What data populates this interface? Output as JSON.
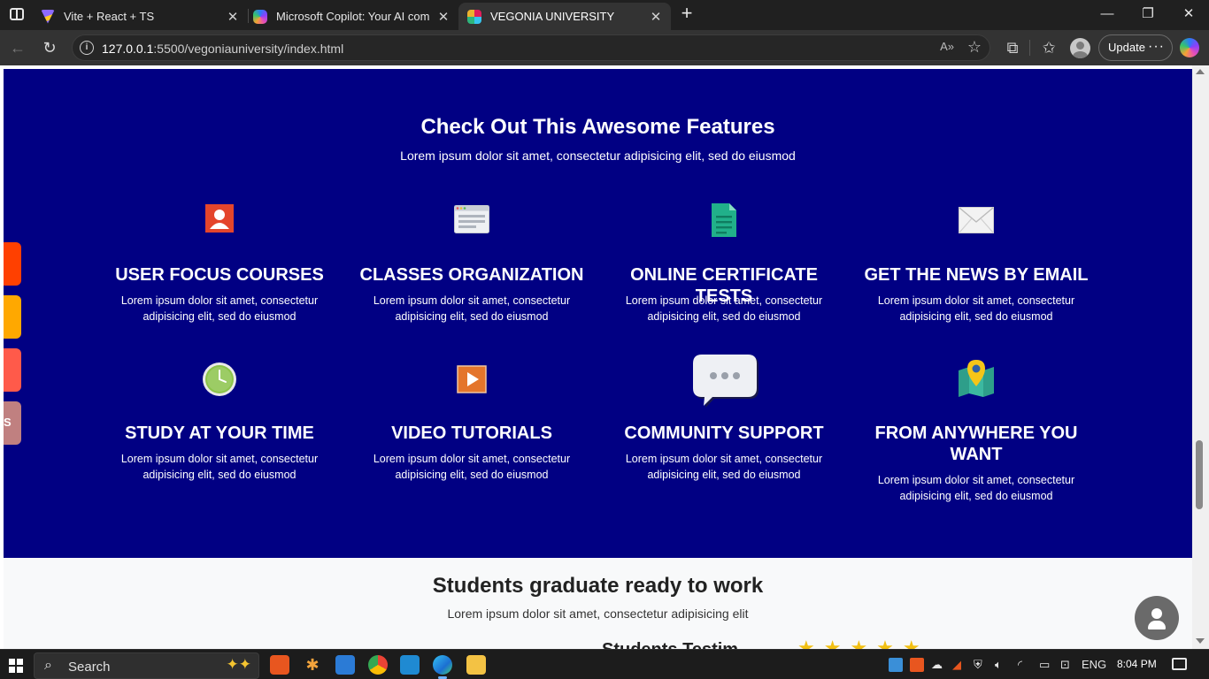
{
  "browser": {
    "tabs": [
      {
        "title": "Vite + React + TS",
        "close": "✕"
      },
      {
        "title": "Microsoft Copilot: Your AI compa",
        "close": "✕"
      },
      {
        "title": "VEGONIA UNIVERSITY",
        "close": "✕"
      }
    ],
    "new_tab": "+",
    "window_controls": {
      "minimize": "—",
      "restore": "❐",
      "close": "✕"
    },
    "url_host": "127.0.0.1",
    "url_path": ":5500/vegoniauniversity/index.html",
    "read_aloud": "A»",
    "update_label": "Update",
    "menu_dots": "···"
  },
  "features": {
    "title": "Check Out This Awesome Features",
    "subtitle": "Lorem ipsum dolor sit amet, consectetur adipisicing elit, sed do eiusmod",
    "items": [
      {
        "title": "USER FOCUS COURSES",
        "desc": "Lorem ipsum dolor sit amet, consectetur adipisicing elit, sed do eiusmod",
        "icon": "user-card-icon"
      },
      {
        "title": "CLASSES ORGANIZATION",
        "desc": "Lorem ipsum dolor sit amet, consectetur adipisicing elit, sed do eiusmod",
        "icon": "browser-window-icon"
      },
      {
        "title": "ONLINE CERTIFICATE TESTS",
        "desc": "Lorem ipsum dolor sit amet, consectetur adipisicing elit, sed do eiusmod",
        "icon": "document-icon"
      },
      {
        "title": "GET THE NEWS BY EMAIL",
        "desc": "Lorem ipsum dolor sit amet, consectetur adipisicing elit, sed do eiusmod",
        "icon": "envelope-icon"
      },
      {
        "title": "STUDY AT YOUR TIME",
        "desc": "Lorem ipsum dolor sit amet, consectetur adipisicing elit, sed do eiusmod",
        "icon": "clock-icon"
      },
      {
        "title": "VIDEO TUTORIALS",
        "desc": "Lorem ipsum dolor sit amet, consectetur adipisicing elit, sed do eiusmod",
        "icon": "play-icon"
      },
      {
        "title": "COMMUNITY SUPPORT",
        "desc": "Lorem ipsum dolor sit amet, consectetur adipisicing elit, sed do eiusmod",
        "icon": "speech-bubble-icon"
      },
      {
        "title": "FROM ANYWHERE YOU WANT",
        "desc": "Lorem ipsum dolor sit amet, consectetur adipisicing elit, sed do eiusmod",
        "icon": "map-pin-icon"
      }
    ]
  },
  "side_tabs": [
    {
      "color": "#ff4000",
      "label": ""
    },
    {
      "color": "#ffa800",
      "label": ""
    },
    {
      "color": "#ff5a4a",
      "label": ""
    },
    {
      "color": "#c08080",
      "label": "S"
    }
  ],
  "graduate": {
    "title": "Students graduate ready to work",
    "subtitle": "Lorem ipsum dolor sit amet, consectetur adipisicing elit",
    "partial_heading": "Students Testim",
    "partial_stars": "★★★★★"
  },
  "taskbar": {
    "search_label": "Search",
    "language": "ENG",
    "time": "8:04 PM"
  },
  "colors": {
    "features_bg": "#010083",
    "graduate_bg": "#f8f9fa",
    "star": "#f2c013"
  }
}
